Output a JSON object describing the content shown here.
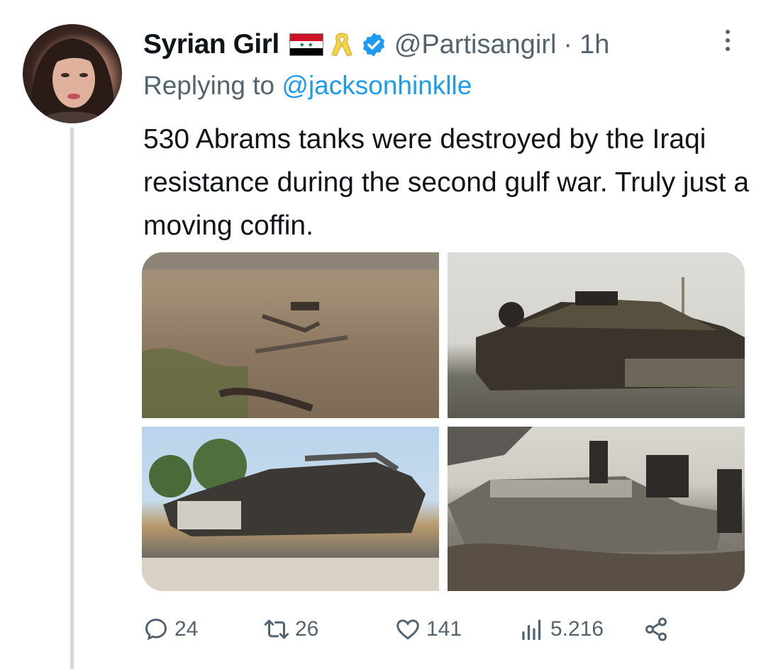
{
  "tweet": {
    "author": {
      "display_name": "Syrian Girl",
      "handle": "@Partisangirl",
      "time": "1h",
      "verified": true,
      "badges": [
        "syria-flag",
        "yellow-ribbon",
        "verified-badge"
      ]
    },
    "reply_prefix": "Replying to",
    "reply_to": "@jacksonhinklle",
    "text": "530 Abrams tanks were destroyed by the Iraqi resistance during the second gulf war. Truly just a moving coffin.",
    "media_count": 4
  },
  "actions": {
    "replies": "24",
    "retweets": "26",
    "likes": "141",
    "views": "5.216"
  },
  "colors": {
    "link_blue": "#1d9bf0",
    "secondary_text": "#536471",
    "thread_line": "#cfd9de"
  }
}
